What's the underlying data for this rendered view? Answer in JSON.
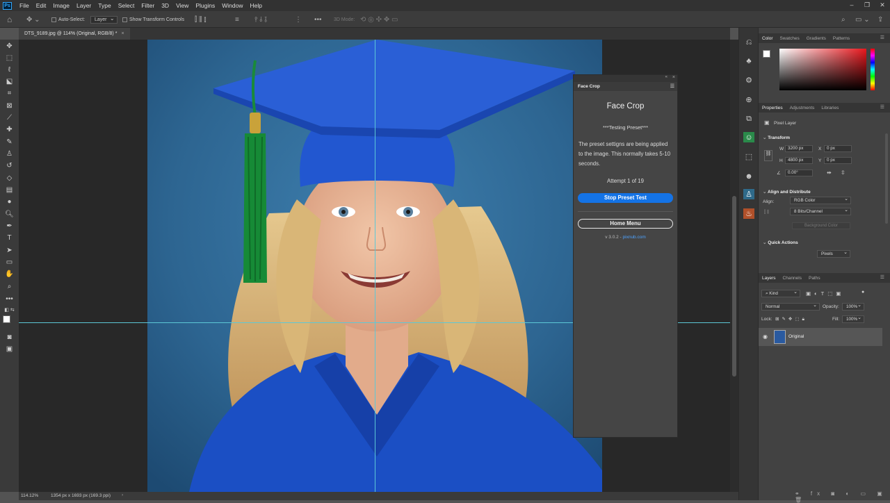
{
  "menu": {
    "logo": "Ps",
    "items": [
      "File",
      "Edit",
      "Image",
      "Layer",
      "Type",
      "Select",
      "Filter",
      "3D",
      "View",
      "Plugins",
      "Window",
      "Help"
    ]
  },
  "options": {
    "auto_select_label": "Auto-Select:",
    "auto_select_target": "Layer",
    "show_transform_label": "Show Transform Controls",
    "mode_3d_label": "3D Mode:"
  },
  "document": {
    "tab_label": "DTS_9189.jpg @ 114% (Original, RGB/8) *",
    "zoom": "114.12%",
    "info": "1354 px x 1693 px (169.3 ppi)"
  },
  "face_crop": {
    "tab": "Face Crop",
    "title": "Face Crop",
    "status": "***Testing Preset***",
    "message": "The preset settigns are being applied to the image. This normally takes 5-10 seconds.",
    "attempt": "Attempt 1 of 19",
    "stop_button": "Stop Preset Test",
    "home_button": "Home Menu",
    "version_prefix": "v 3.0.2 - ",
    "version_link": "pixnub.com"
  },
  "color_panel": {
    "tabs": [
      "Color",
      "Swatches",
      "Gradients",
      "Patterns"
    ]
  },
  "properties_panel": {
    "tabs": [
      "Properties",
      "Adjustments",
      "Libraries"
    ],
    "layer_type": "Pixel Layer",
    "transform_title": "Transform",
    "w_label": "W",
    "w_value": "3200 px",
    "h_label": "H",
    "h_value": "4800 px",
    "x_label": "X",
    "x_value": "0 px",
    "y_label": "Y",
    "y_value": "0 px",
    "angle_value": "0.00°",
    "align_title": "Align and Distribute",
    "align_label": "Align:",
    "mode_value": "RGB Color",
    "depth_value": "8 Bits/Channel",
    "background_label": "Background Color",
    "quick_title": "Quick Actions",
    "units_value": "Pixels"
  },
  "layers_panel": {
    "tabs": [
      "Layers",
      "Channels",
      "Paths"
    ],
    "kind_filter": "Kind",
    "blend_mode": "Normal",
    "opacity_label": "Opacity:",
    "opacity_value": "100%",
    "lock_label": "Lock:",
    "fill_label": "Fill:",
    "fill_value": "100%",
    "layers": [
      {
        "name": "Original",
        "visible": true
      }
    ]
  },
  "colors": {
    "accent_blue": "#1473e6",
    "guide": "#5cc8d6",
    "link": "#4da3ff"
  }
}
